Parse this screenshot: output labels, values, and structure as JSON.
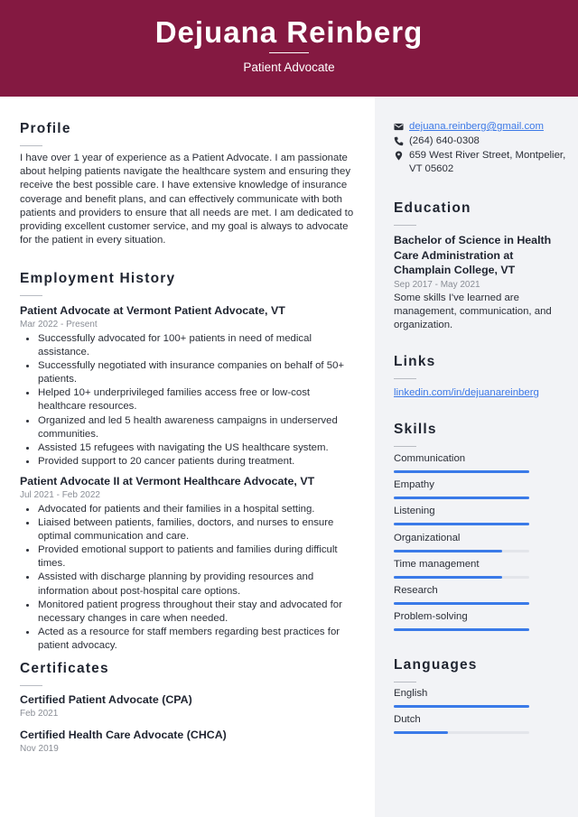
{
  "header": {
    "name": "Dejuana Reinberg",
    "title": "Patient Advocate",
    "accent_color": "#841941"
  },
  "profile": {
    "heading": "Profile",
    "text": "I have over 1 year of experience as a Patient Advocate. I am passionate about helping patients navigate the healthcare system and ensuring they receive the best possible care. I have extensive knowledge of insurance coverage and benefit plans, and can effectively communicate with both patients and providers to ensure that all needs are met. I am dedicated to providing excellent customer service, and my goal is always to advocate for the patient in every situation."
  },
  "employment": {
    "heading": "Employment History",
    "jobs": [
      {
        "title": "Patient Advocate at Vermont Patient Advocate, VT",
        "dates": "Mar 2022 - Present",
        "bullets": [
          "Successfully advocated for 100+ patients in need of medical assistance.",
          "Successfully negotiated with insurance companies on behalf of 50+ patients.",
          "Helped 10+ underprivileged families access free or low-cost healthcare resources.",
          "Organized and led 5 health awareness campaigns in underserved communities.",
          "Assisted 15 refugees with navigating the US healthcare system.",
          "Provided support to 20 cancer patients during treatment."
        ]
      },
      {
        "title": "Patient Advocate II at Vermont Healthcare Advocate, VT",
        "dates": "Jul 2021 - Feb 2022",
        "bullets": [
          "Advocated for patients and their families in a hospital setting.",
          "Liaised between patients, families, doctors, and nurses to ensure optimal communication and care.",
          "Provided emotional support to patients and families during difficult times.",
          "Assisted with discharge planning by providing resources and information about post-hospital care options.",
          "Monitored patient progress throughout their stay and advocated for necessary changes in care when needed.",
          "Acted as a resource for staff members regarding best practices for patient advocacy."
        ]
      }
    ]
  },
  "certificates": {
    "heading": "Certificates",
    "items": [
      {
        "name": "Certified Patient Advocate (CPA)",
        "date": "Feb 2021"
      },
      {
        "name": "Certified Health Care Advocate (CHCA)",
        "date": "Nov 2019"
      }
    ]
  },
  "contact": {
    "email": {
      "icon": "envelope-icon",
      "value": "dejuana.reinberg@gmail.com"
    },
    "phone": {
      "icon": "phone-icon",
      "value": "(264) 640-0308"
    },
    "address": {
      "icon": "map-pin-icon",
      "value": "659 West River Street, Montpelier, VT 05602"
    }
  },
  "education": {
    "heading": "Education",
    "degree": "Bachelor of Science in Health Care Administration at Champlain College, VT",
    "dates": "Sep 2017 - May 2021",
    "description": "Some skills I've learned are management, communication, and organization."
  },
  "links": {
    "heading": "Links",
    "items": [
      {
        "label": "linkedin.com/in/dejuanareinberg"
      }
    ]
  },
  "skills": {
    "heading": "Skills",
    "bar_color": "#3a7ae8",
    "items": [
      {
        "label": "Communication",
        "level_pct": 100
      },
      {
        "label": "Empathy",
        "level_pct": 100
      },
      {
        "label": "Listening",
        "level_pct": 100
      },
      {
        "label": "Organizational",
        "level_pct": 80
      },
      {
        "label": "Time management",
        "level_pct": 80
      },
      {
        "label": "Research",
        "level_pct": 100
      },
      {
        "label": "Problem-solving",
        "level_pct": 100
      }
    ]
  },
  "languages": {
    "heading": "Languages",
    "items": [
      {
        "label": "English",
        "level_pct": 100
      },
      {
        "label": "Dutch",
        "level_pct": 40
      }
    ]
  }
}
